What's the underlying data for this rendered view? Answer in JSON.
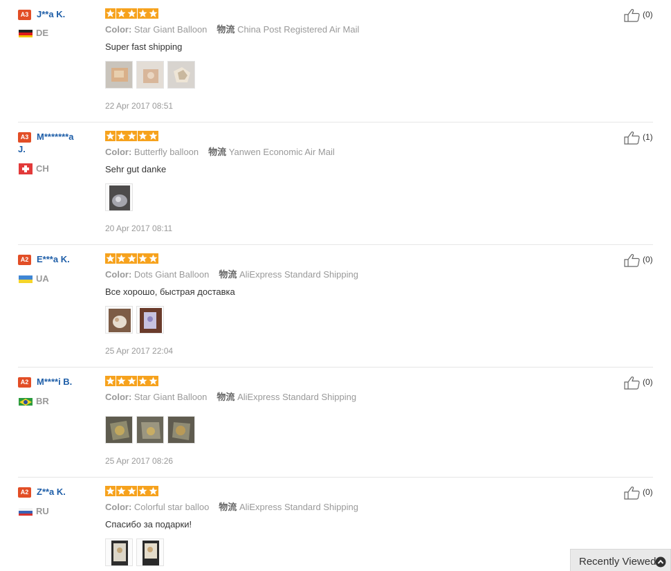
{
  "reviews": [
    {
      "level": "A3",
      "name": "J**a K.",
      "country": "DE",
      "flag": "de",
      "rating": 5,
      "color_label": "Color:",
      "color_value": "Star Giant Balloon",
      "ship_label": "物流",
      "ship_value": "China Post Registered Air Mail",
      "text": "Super fast shipping",
      "date": "22 Apr 2017 08:51",
      "helpful": "(0)"
    },
    {
      "level": "A3",
      "name": "M*******a J.",
      "country": "CH",
      "flag": "ch",
      "rating": 5,
      "color_label": "Color:",
      "color_value": "Butterfly balloon",
      "ship_label": "物流",
      "ship_value": "Yanwen Economic Air Mail",
      "text": "Sehr gut danke",
      "date": "20 Apr 2017 08:11",
      "helpful": "(1)"
    },
    {
      "level": "A2",
      "name": "E***a K.",
      "country": "UA",
      "flag": "ua",
      "rating": 5,
      "color_label": "Color:",
      "color_value": "Dots Giant Balloon",
      "ship_label": "物流",
      "ship_value": "AliExpress Standard Shipping",
      "text": "Все хорошо, быстрая доставка",
      "date": "25 Apr 2017 22:04",
      "helpful": "(0)"
    },
    {
      "level": "A2",
      "name": "M****i B.",
      "country": "BR",
      "flag": "br",
      "rating": 5,
      "color_label": "Color:",
      "color_value": "Star Giant Balloon",
      "ship_label": "物流",
      "ship_value": "AliExpress Standard Shipping",
      "text": "",
      "date": "25 Apr 2017 08:26",
      "helpful": "(0)"
    },
    {
      "level": "A2",
      "name": "Z**a K.",
      "country": "RU",
      "flag": "ru",
      "rating": 5,
      "color_label": "Color:",
      "color_value": "Colorful star balloo",
      "ship_label": "物流",
      "ship_value": "AliExpress Standard Shipping",
      "text": "Спасибо за подарки!",
      "date": "",
      "helpful": "(0)"
    }
  ],
  "recently_viewed": {
    "label": "Recently Viewed",
    "icon": "chevron-up-circle-icon"
  },
  "colors": {
    "star": "#f6a21d",
    "level_badge": "#e24e26",
    "username": "#1e5ea8"
  }
}
